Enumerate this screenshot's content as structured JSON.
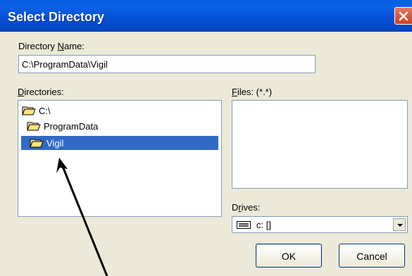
{
  "window": {
    "title": "Select Directory",
    "close_icon": "close-icon"
  },
  "directory_name": {
    "label_prefix": "Directory ",
    "label_accel": "N",
    "label_suffix": "ame:",
    "value": "C:\\ProgramData\\Vigil"
  },
  "directories": {
    "label_accel": "D",
    "label_suffix": "irectories:",
    "items": [
      {
        "label": "C:\\",
        "icon": "open-folder-icon",
        "selected": false
      },
      {
        "label": "ProgramData",
        "icon": "open-folder-icon",
        "selected": false
      },
      {
        "label": "Vigil",
        "icon": "open-folder-icon",
        "selected": true
      }
    ]
  },
  "files": {
    "label_accel": "F",
    "label_suffix": "iles: (*.*)"
  },
  "drives": {
    "label_prefix": "D",
    "label_accel": "r",
    "label_suffix": "ives:",
    "selected": "c: []",
    "icon": "drive-icon"
  },
  "buttons": {
    "ok": "OK",
    "cancel": "Cancel"
  },
  "colors": {
    "titlebar": "#0554d8",
    "selection": "#316ac5",
    "dialog_bg": "#ece9d8"
  }
}
